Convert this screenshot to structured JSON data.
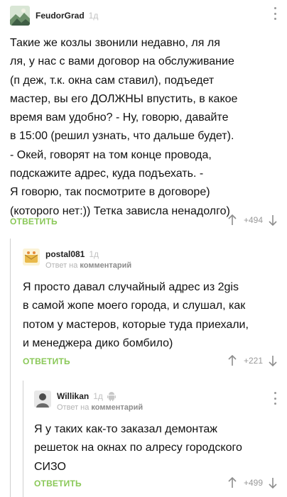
{
  "comments": [
    {
      "author": "FeudorGrad",
      "time": "1д",
      "reply_to_prefix": "",
      "reply_to_link": "",
      "text": "Такие же козлы звонили недавно, ля ля\nля, у нас с вами договор на обслуживание\n(п    деж, т.к. окна сам ставил), подъедет\nмастер, вы его ДОЛЖНЫ впустить, в какое\nвремя вам удобно? - Ну, говорю, давайте\nв 15:00 (решил узнать, что дальше будет).\n- Окей, говорят на том конце провода,\nподскажите адрес, куда подъехать. -\nЯ говорю, так посмотрите в договоре)\n(которого нет:)) Тетка зависла ненадолго)",
      "reply_label": "ОТВЕТИТЬ",
      "score": "+494"
    },
    {
      "author": "postal081",
      "time": "1д",
      "reply_to_prefix": "Ответ на",
      "reply_to_link": "комментарий",
      "text": "Я просто давал случайный адрес из 2gis\nв самой жопе моего города, и слушал, как\nпотом у мастеров, которые туда приехали,\nи менеджера дико бомбило)",
      "reply_label": "ОТВЕТИТЬ",
      "score": "+221"
    },
    {
      "author": "Willikan",
      "time": "1д",
      "reply_to_prefix": "Ответ на",
      "reply_to_link": "комментарий",
      "text": "Я у таких как-то заказал демонтаж\nрешеток на окнах по алресу городского\nСИЗО",
      "reply_label": "ОТВЕТИТЬ",
      "score": "+499"
    }
  ],
  "icons": {
    "more": "more-vertical-icon",
    "upvote": "arrow-up-icon",
    "downvote": "arrow-down-icon",
    "android": "android-icon"
  },
  "colors": {
    "reply": "#8ac858",
    "muted": "#9a9a9a",
    "thread_line": "#cfcfcf"
  }
}
